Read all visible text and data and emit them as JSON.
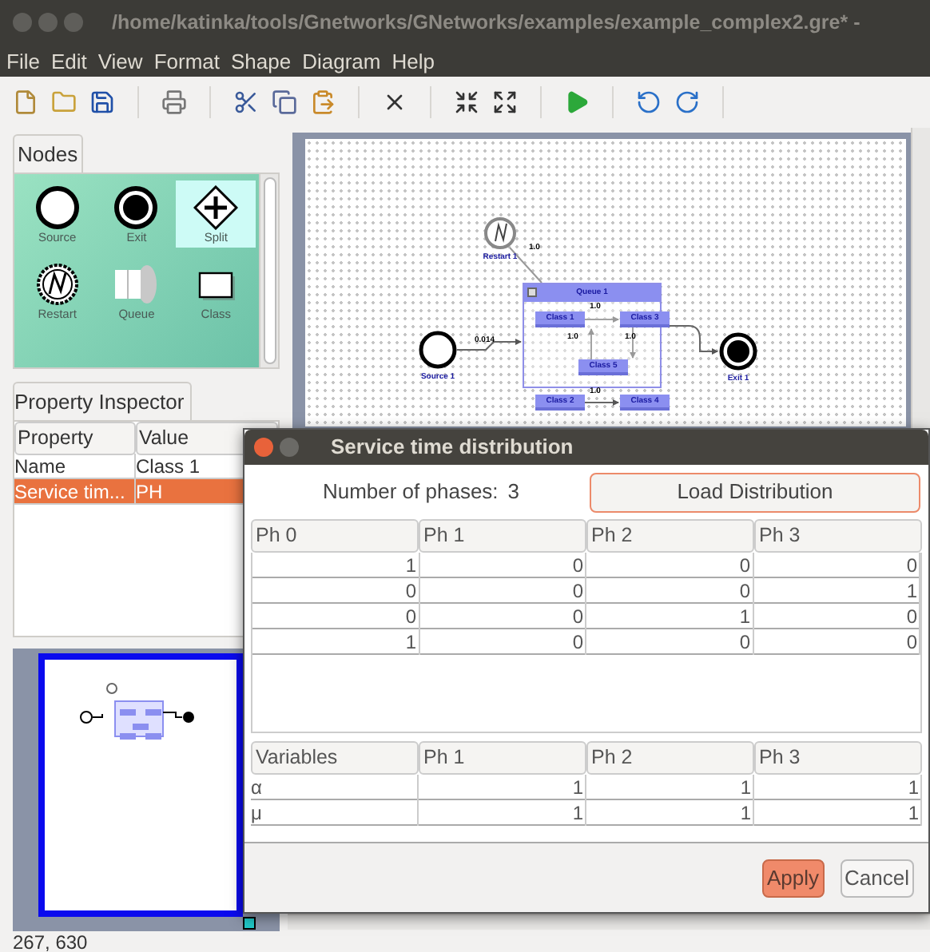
{
  "window": {
    "title": "/home/katinka/tools/Gnetworks/GNetworks/examples/example_complex2.gre* -"
  },
  "menu": [
    "File",
    "Edit",
    "View",
    "Format",
    "Shape",
    "Diagram",
    "Help"
  ],
  "nodes_panel": {
    "tab": "Nodes",
    "items": [
      {
        "label": "Source",
        "kind": "source",
        "selected": false
      },
      {
        "label": "Exit",
        "kind": "exit",
        "selected": false
      },
      {
        "label": "Split",
        "kind": "split",
        "selected": true
      },
      {
        "label": "Restart",
        "kind": "restart",
        "selected": false
      },
      {
        "label": "Queue",
        "kind": "queue",
        "selected": false
      },
      {
        "label": "Class",
        "kind": "class",
        "selected": false
      }
    ]
  },
  "inspector": {
    "tab": "Property Inspector",
    "columns": [
      "Property",
      "Value"
    ],
    "rows": [
      {
        "cells": [
          "Name",
          "Class 1"
        ],
        "selected": false
      },
      {
        "cells": [
          "Service tim...",
          "PH"
        ],
        "selected": true
      }
    ]
  },
  "diagram": {
    "nodes": [
      {
        "kind": "restart",
        "label": "Restart 1"
      },
      {
        "kind": "source",
        "label": "Source 1"
      },
      {
        "kind": "exit",
        "label": "Exit 1"
      },
      {
        "kind": "queue",
        "label": "Queue 1"
      },
      {
        "kind": "class",
        "label": "Class 1"
      },
      {
        "kind": "class",
        "label": "Class 3"
      },
      {
        "kind": "class",
        "label": "Class 5"
      },
      {
        "kind": "class",
        "label": "Class 2"
      },
      {
        "kind": "class",
        "label": "Class 4"
      }
    ],
    "edge_labels": [
      "1.0",
      "0.014",
      "1.0",
      "1.0",
      "1.0",
      "1.0"
    ]
  },
  "status_bar": "267, 630",
  "dialog": {
    "title": "Service time distribution",
    "phases_label": "Number of phases:",
    "phases_value": "3",
    "load_button": "Load Distribution",
    "matrix": {
      "columns": [
        "Ph 0",
        "Ph 1",
        "Ph 2",
        "Ph 3"
      ],
      "rows": [
        [
          "1",
          "0",
          "0",
          "0"
        ],
        [
          "0",
          "0",
          "0",
          "1"
        ],
        [
          "0",
          "0",
          "1",
          "0"
        ],
        [
          "1",
          "0",
          "0",
          "0"
        ]
      ]
    },
    "variables": {
      "columns": [
        "Variables",
        "Ph 1",
        "Ph 2",
        "Ph 3"
      ],
      "rows": [
        [
          "α",
          "1",
          "1",
          "1"
        ],
        [
          "μ",
          "1",
          "1",
          "1"
        ]
      ]
    },
    "buttons": [
      {
        "label": "Apply",
        "kind": "primary"
      },
      {
        "label": "Cancel",
        "kind": "secondary"
      }
    ]
  }
}
